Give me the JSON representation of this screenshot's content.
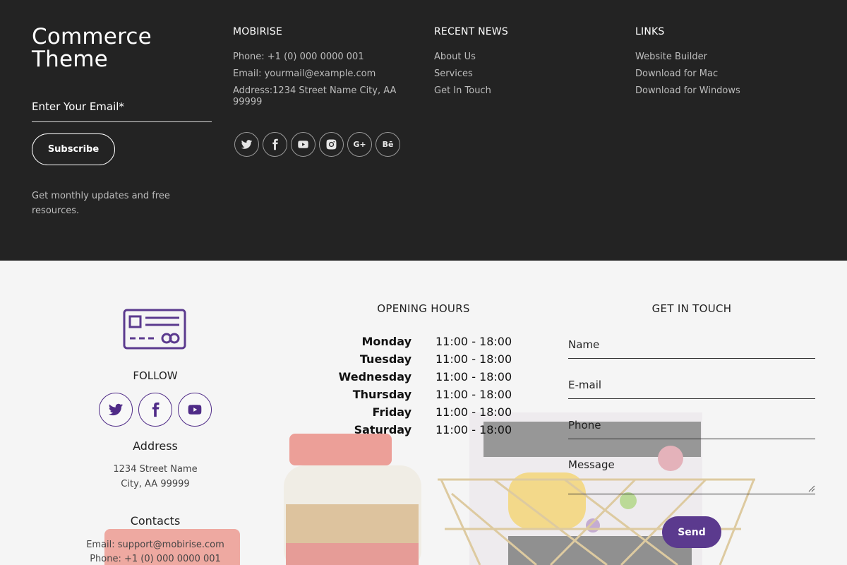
{
  "footer": {
    "brand": "Commerce Theme",
    "email_label": "Enter Your Email*",
    "subscribe_label": "Subscribe",
    "tagline": "Get monthly updates and free resources.",
    "columns": [
      {
        "title": "MOBIRISE",
        "items": [
          "Phone: +1 (0) 000 0000 001",
          "Email: yourmail@example.com",
          "Address:1234 Street Name City, AA 99999"
        ]
      },
      {
        "title": "RECENT NEWS",
        "items": [
          "About Us",
          "Services",
          "Get In Touch"
        ]
      },
      {
        "title": "LINKS",
        "items": [
          "Website Builder",
          "Download for Mac",
          "Download for Windows"
        ]
      }
    ],
    "social_icons": [
      "twitter-icon",
      "facebook-icon",
      "youtube-icon",
      "instagram-icon",
      "google-plus-icon",
      "behance-icon"
    ],
    "social_text": {
      "google_plus": "G+",
      "behance": "Bē"
    }
  },
  "contact": {
    "follow_label": "FOLLOW",
    "follow_icons": [
      "twitter-icon",
      "facebook-icon",
      "youtube-icon"
    ],
    "address_title": "Address",
    "address_lines": [
      "1234 Street Name",
      "City, AA 99999"
    ],
    "contacts_title": "Contacts",
    "contact_lines": [
      "Email: support@mobirise.com",
      "Phone: +1 (0) 000 0000 001"
    ],
    "hours_title": "OPENING HOURS",
    "hours": [
      {
        "day": "Monday",
        "time": "11:00 - 18:00"
      },
      {
        "day": "Tuesday",
        "time": "11:00 - 18:00"
      },
      {
        "day": "Wednesday",
        "time": "11:00 - 18:00"
      },
      {
        "day": "Thursday",
        "time": "11:00 - 18:00"
      },
      {
        "day": "Friday",
        "time": "11:00 - 18:00"
      },
      {
        "day": "Saturday",
        "time": "11:00 - 18:00"
      }
    ],
    "get_in_touch_title": "GET IN TOUCH",
    "form": {
      "name_placeholder": "Name",
      "email_placeholder": "E-mail",
      "phone_placeholder": "Phone",
      "message_placeholder": "Message",
      "send_label": "Send"
    }
  },
  "colors": {
    "dark_bg": "#232323",
    "accent_purple": "#5b3a8e"
  }
}
